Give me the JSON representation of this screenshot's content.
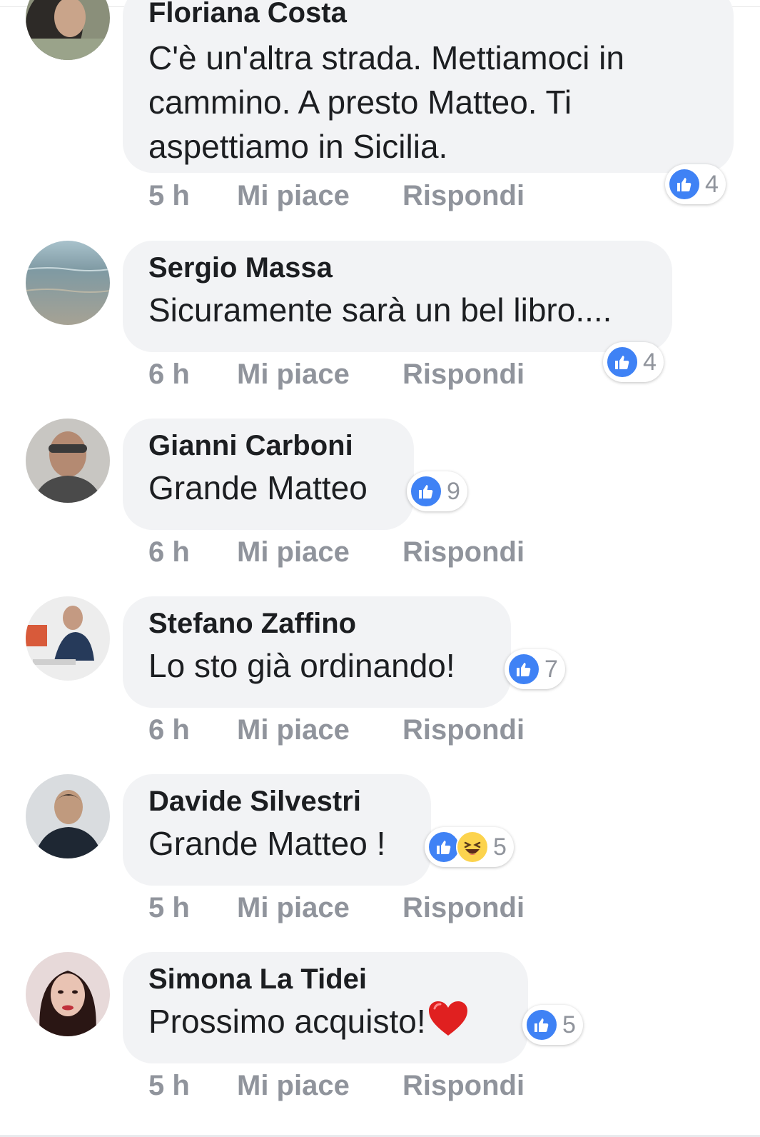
{
  "colors": {
    "bubble": "#f2f3f5",
    "text": "#1c1e21",
    "muted": "#90949c",
    "like_blue": "#3f82f5",
    "haha_yellow": "#fcd34d",
    "heart_red": "#e02020"
  },
  "actions_labels": {
    "like": "Mi piace",
    "reply": "Rispondi"
  },
  "comments": [
    {
      "author": "Floriana Costa",
      "text": "C'è un'altra strada. Mettiamoci in cammino. A presto Matteo. Ti aspettiamo in Sicilia.",
      "time": "5 h",
      "reactions": [
        "like-icon"
      ],
      "reaction_count": "4"
    },
    {
      "author": "Sergio Massa",
      "text": "Sicuramente sarà un bel libro....",
      "time": "6 h",
      "reactions": [
        "like-icon"
      ],
      "reaction_count": "4"
    },
    {
      "author": "Gianni Carboni",
      "text": "Grande Matteo",
      "time": "6 h",
      "reactions": [
        "like-icon"
      ],
      "reaction_count": "9"
    },
    {
      "author": "Stefano Zaffino",
      "text": "Lo sto già ordinando!",
      "time": "6 h",
      "reactions": [
        "like-icon"
      ],
      "reaction_count": "7"
    },
    {
      "author": "Davide Silvestri",
      "text": "Grande Matteo !",
      "time": "5 h",
      "reactions": [
        "like-icon",
        "haha-icon"
      ],
      "reaction_count": "5"
    },
    {
      "author": "Simona La Tidei",
      "text": "Prossimo acquisto!",
      "text_emoji": "heart-icon",
      "time": "5 h",
      "reactions": [
        "like-icon"
      ],
      "reaction_count": "5"
    }
  ]
}
